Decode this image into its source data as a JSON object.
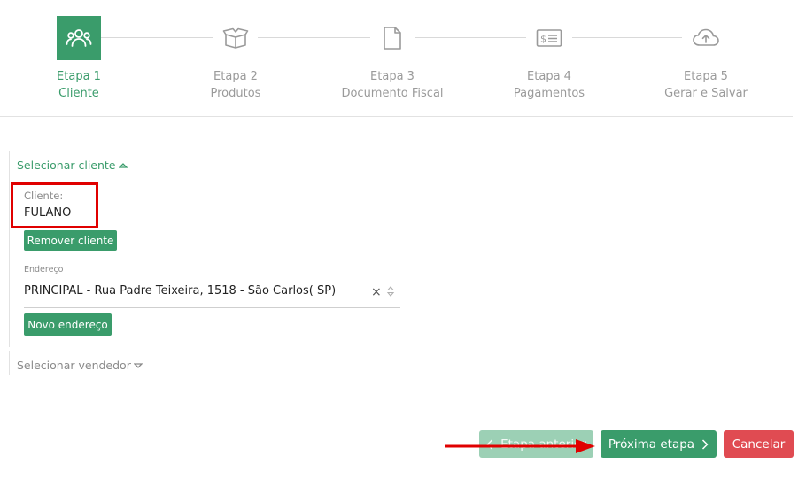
{
  "stepper": {
    "steps": [
      {
        "num": "Etapa 1",
        "name": "Cliente",
        "icon": "users-icon",
        "active": true
      },
      {
        "num": "Etapa 2",
        "name": "Produtos",
        "icon": "box-icon",
        "active": false
      },
      {
        "num": "Etapa 3",
        "name": "Documento Fiscal",
        "icon": "document-icon",
        "active": false
      },
      {
        "num": "Etapa 4",
        "name": "Pagamentos",
        "icon": "money-icon",
        "active": false
      },
      {
        "num": "Etapa 5",
        "name": "Gerar e Salvar",
        "icon": "cloud-upload-icon",
        "active": false
      }
    ]
  },
  "client": {
    "select_label": "Selecionar cliente",
    "field_label": "Cliente:",
    "field_value": "FULANO",
    "remove_button": "Remover cliente",
    "address_label": "Endereço",
    "address_value": "PRINCIPAL - Rua Padre Teixeira, 1518 - São Carlos( SP)",
    "new_address_button": "Novo endereço",
    "clear_symbol": "×"
  },
  "seller": {
    "select_label": "Selecionar vendedor"
  },
  "footer": {
    "prev_label": "Etapa anterior",
    "next_label": "Próxima etapa",
    "cancel_label": "Cancelar"
  },
  "colors": {
    "accent": "#3a9c6b",
    "danger": "#e04b52",
    "highlight": "#e00000"
  }
}
